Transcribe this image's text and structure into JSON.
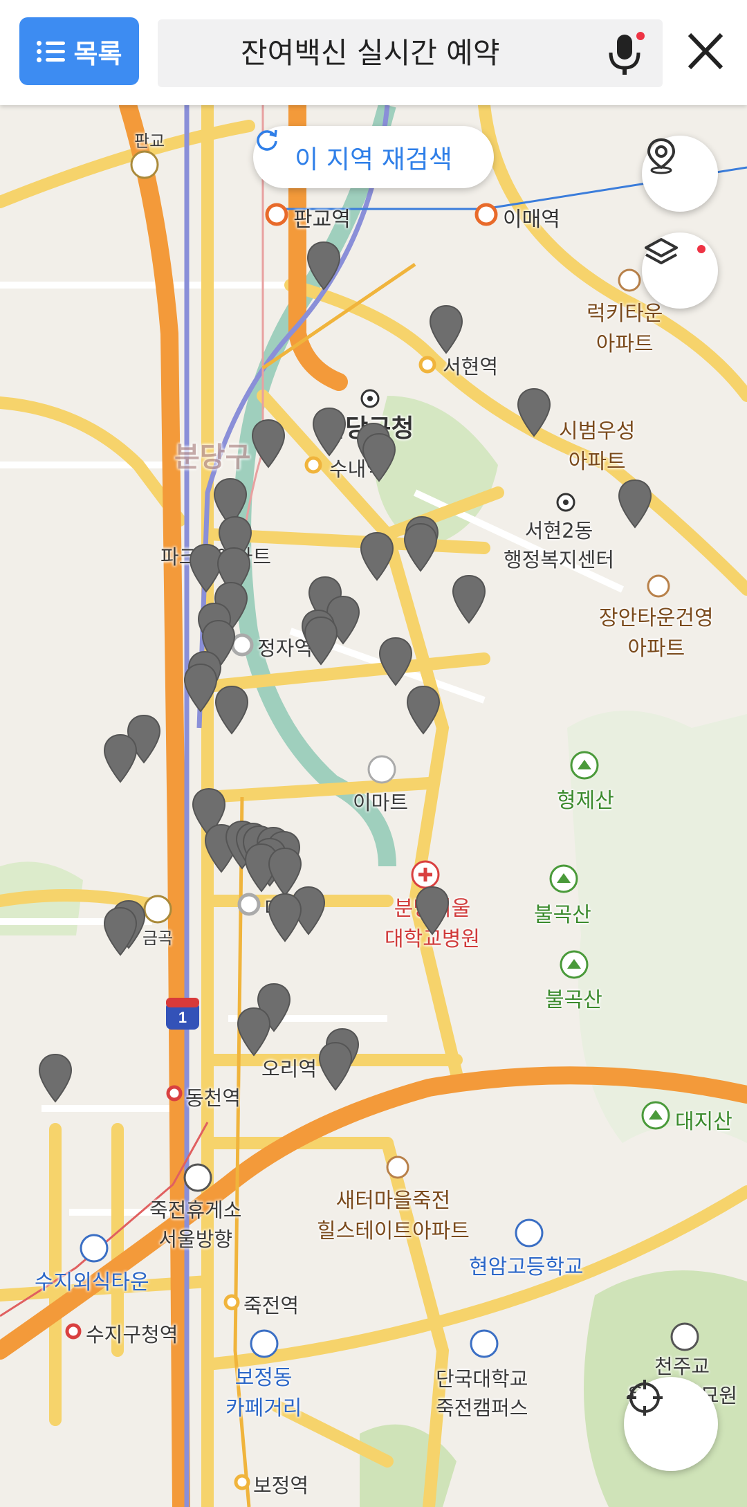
{
  "header": {
    "list_button_label": "목록",
    "search_query": "잔여백신 실시간 예약"
  },
  "map": {
    "research_button_label": "이 지역 재검색",
    "labels": {
      "pangyo_ic": "판교",
      "pangyo_station": "판교역",
      "imae_station": "이매역",
      "seohyeon_station": "서현역",
      "bundang_gu_office": "분당구청",
      "sunae_station": "수내역",
      "bundang_gu": "분당구",
      "lucky_town_apt": "럭키타운\n아파트",
      "sibum_apt": "시범우성\n아파트",
      "seohyeon2dong_center": "서현2동\n행정복지센터",
      "jangan_town_apt": "장안타운건영\n아파트",
      "park_view_apt": "파크뷰아파트",
      "jeongja_station": "정자역",
      "emart": "이마트",
      "hyeongjesan": "형제산",
      "bulgoksan_1": "불곡산",
      "bulgoksan_2": "불곡산",
      "geumgok_ic": "금곡",
      "migeum_station": "미금역",
      "seoul_univ_hospital": "분당서울\n대학교병원",
      "ori_station": "오리역",
      "dongcheon_station": "동천역",
      "daejisan": "대지산",
      "jukjeon_rest_area": "죽전휴게소\n서울방향",
      "saeteo_hillstate": "새터마을죽전\n힐스테이트아파트",
      "hyeonam_high": "현암고등학교",
      "suji_restaurant": "수지외식타운",
      "jukjeon_station": "죽전역",
      "sujigu_office_station": "수지구청역",
      "bojeong_cafe": "보정동\n카페거리",
      "dankook_univ": "단국대학교\n죽전캠퍼스",
      "cheonju_cemetery": "천주교\n용인공원묘원",
      "bojeong_station": "보정역",
      "highway_shield": "1"
    },
    "marker_color": "#6e6e6e"
  },
  "icons": {
    "list": "list-icon",
    "mic": "microphone-icon",
    "close": "close-icon",
    "refresh": "refresh-icon",
    "vaccine_place": "location-pin-icon",
    "layers": "layers-icon",
    "my_location": "crosshair-icon"
  },
  "colors": {
    "accent": "#3d8cf2",
    "map_bg": "#f2efe9",
    "expressway": "#f39a3a",
    "road": "#f8d86a",
    "river": "#8fc3b0",
    "green_area": "#cfe3b8"
  }
}
